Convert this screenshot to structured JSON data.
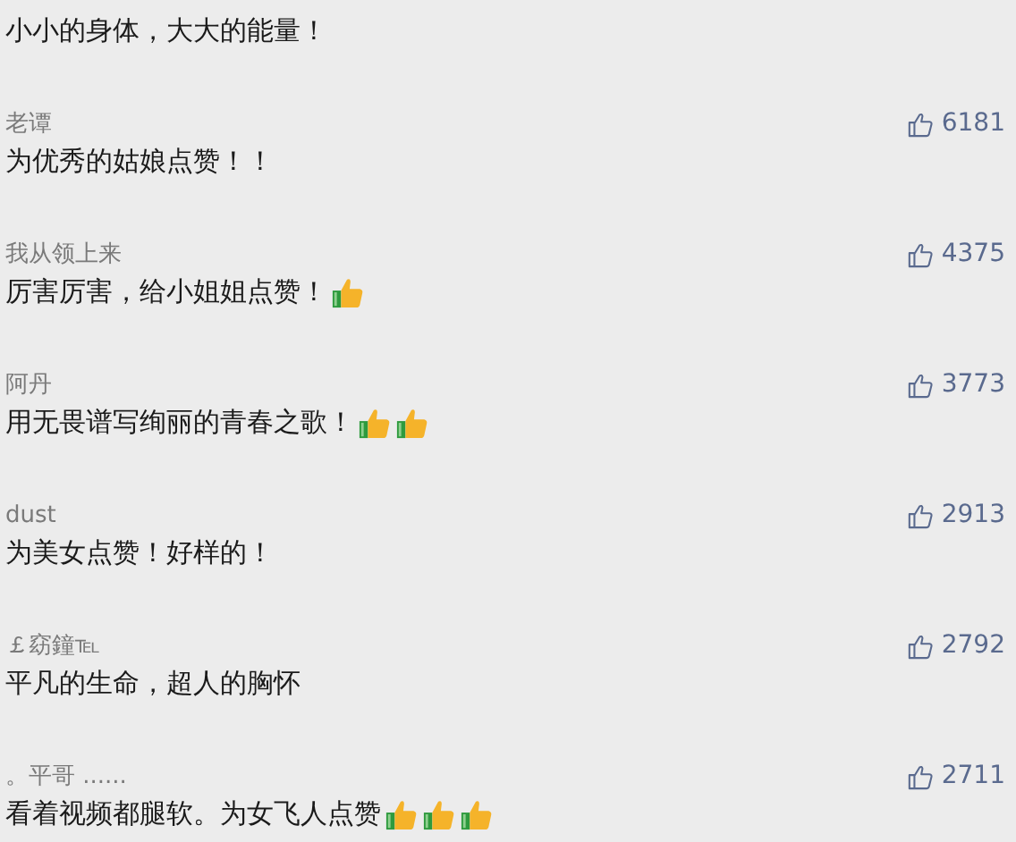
{
  "comments": [
    {
      "text": "小小的身体，大大的能量！"
    },
    {
      "user": "老谭",
      "likes": "6181",
      "text": "为优秀的姑娘点赞！！"
    },
    {
      "user": "我从领上来",
      "likes": "4375",
      "text": "厉害厉害，给小姐姐点赞！",
      "reactions": [
        {
          "kind": "thumbs-up"
        }
      ]
    },
    {
      "user": "阿丹",
      "likes": "3773",
      "text": "用无畏谱写绚丽的青春之歌！",
      "reactions": [
        {
          "kind": "thumbs-up"
        },
        {
          "kind": "thumbs-up"
        }
      ]
    },
    {
      "user": "dust",
      "likes": "2913",
      "text": "为美女点赞！好样的！"
    },
    {
      "user": "￡窈鐘℡",
      "likes": "2792",
      "text": "平凡的生命，超人的胸怀"
    },
    {
      "user": "。平哥 ......",
      "likes": "2711",
      "text": "看着视频都腿软。为女飞人点赞",
      "reactions": [
        {
          "kind": "thumbs-up"
        },
        {
          "kind": "thumbs-up"
        },
        {
          "kind": "thumbs-up"
        }
      ]
    }
  ]
}
